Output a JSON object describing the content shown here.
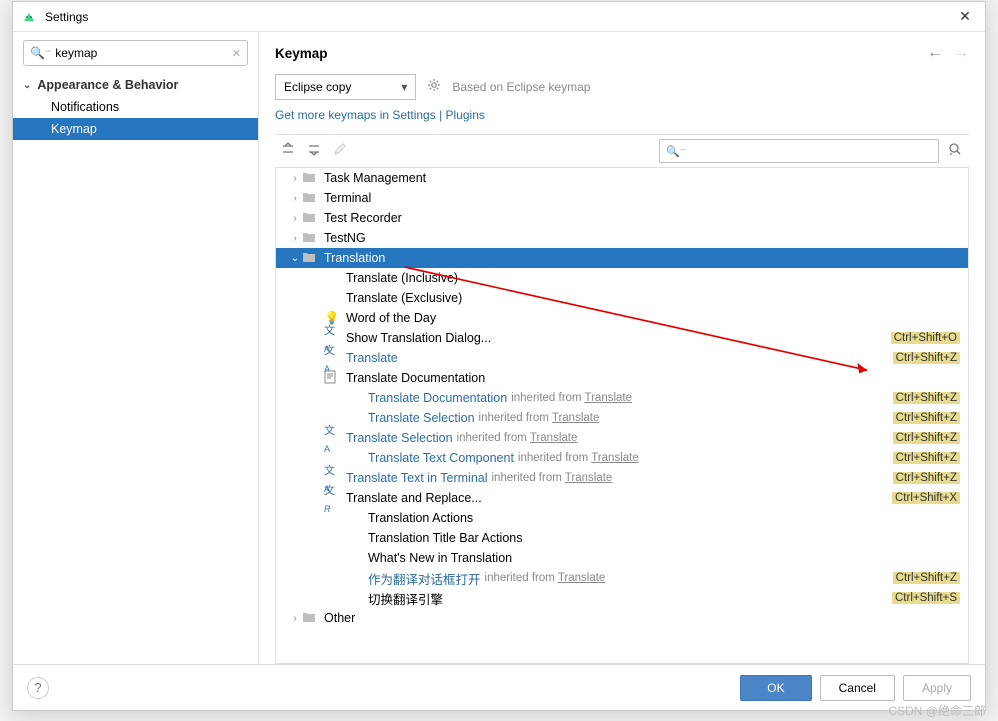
{
  "window": {
    "title": "Settings"
  },
  "sidebar": {
    "search": {
      "value": "keymap"
    },
    "group": "Appearance & Behavior",
    "items": [
      "Notifications",
      "Keymap"
    ],
    "selected_index": 1
  },
  "main": {
    "title": "Keymap",
    "scheme": "Eclipse copy",
    "based_on": "Based on Eclipse keymap",
    "link1": "Get more keymaps in Settings | Plugins"
  },
  "tree": [
    {
      "depth": 0,
      "arrow": "right",
      "icon": "folder",
      "label": "Task Management"
    },
    {
      "depth": 0,
      "arrow": "right",
      "icon": "folder",
      "label": "Terminal"
    },
    {
      "depth": 0,
      "arrow": "right",
      "icon": "folder",
      "label": "Test Recorder"
    },
    {
      "depth": 0,
      "arrow": "right",
      "icon": "folder",
      "label": "TestNG"
    },
    {
      "depth": 0,
      "arrow": "down",
      "icon": "folder",
      "label": "Translation",
      "selected": true
    },
    {
      "depth": 1,
      "label": "Translate (Inclusive)"
    },
    {
      "depth": 1,
      "label": "Translate (Exclusive)"
    },
    {
      "depth": 1,
      "icon": "bulb",
      "label": "Word of the Day"
    },
    {
      "depth": 1,
      "icon": "trans",
      "label": "Show Translation Dialog...",
      "shortcut": "Ctrl+Shift+O"
    },
    {
      "depth": 1,
      "icon": "trans",
      "label": "Translate",
      "link": true,
      "shortcut": "Ctrl+Shift+Z"
    },
    {
      "depth": 1,
      "icon": "doc",
      "label": "Translate Documentation"
    },
    {
      "depth": 2,
      "label": "Translate Documentation",
      "link": true,
      "inherited_from": "Translate",
      "shortcut": "Ctrl+Shift+Z"
    },
    {
      "depth": 2,
      "label": "Translate Selection",
      "link": true,
      "inherited_from": "Translate",
      "shortcut": "Ctrl+Shift+Z"
    },
    {
      "depth": 1,
      "icon": "trans",
      "label": "Translate Selection",
      "link": true,
      "inherited_from": "Translate",
      "shortcut": "Ctrl+Shift+Z"
    },
    {
      "depth": 2,
      "label": "Translate Text Component",
      "link": true,
      "inherited_from": "Translate",
      "shortcut": "Ctrl+Shift+Z"
    },
    {
      "depth": 1,
      "icon": "trans",
      "label": "Translate Text in Terminal",
      "link": true,
      "inherited_from": "Translate",
      "shortcut": "Ctrl+Shift+Z"
    },
    {
      "depth": 1,
      "icon": "transR",
      "label": "Translate and Replace...",
      "shortcut": "Ctrl+Shift+X"
    },
    {
      "depth": 2,
      "label": "Translation Actions"
    },
    {
      "depth": 2,
      "label": "Translation Title Bar Actions"
    },
    {
      "depth": 2,
      "label": "What's New in Translation"
    },
    {
      "depth": 2,
      "label": "作为翻译对话框打开",
      "link": true,
      "inherited_from": "Translate",
      "shortcut": "Ctrl+Shift+Z"
    },
    {
      "depth": 2,
      "label": "切换翻译引擎",
      "shortcut": "Ctrl+Shift+S"
    },
    {
      "depth": 0,
      "arrow": "right",
      "icon": "folder",
      "label": "Other"
    }
  ],
  "footer": {
    "ok": "OK",
    "cancel": "Cancel",
    "apply": "Apply"
  },
  "watermark": "CSDN @绝命三郎"
}
